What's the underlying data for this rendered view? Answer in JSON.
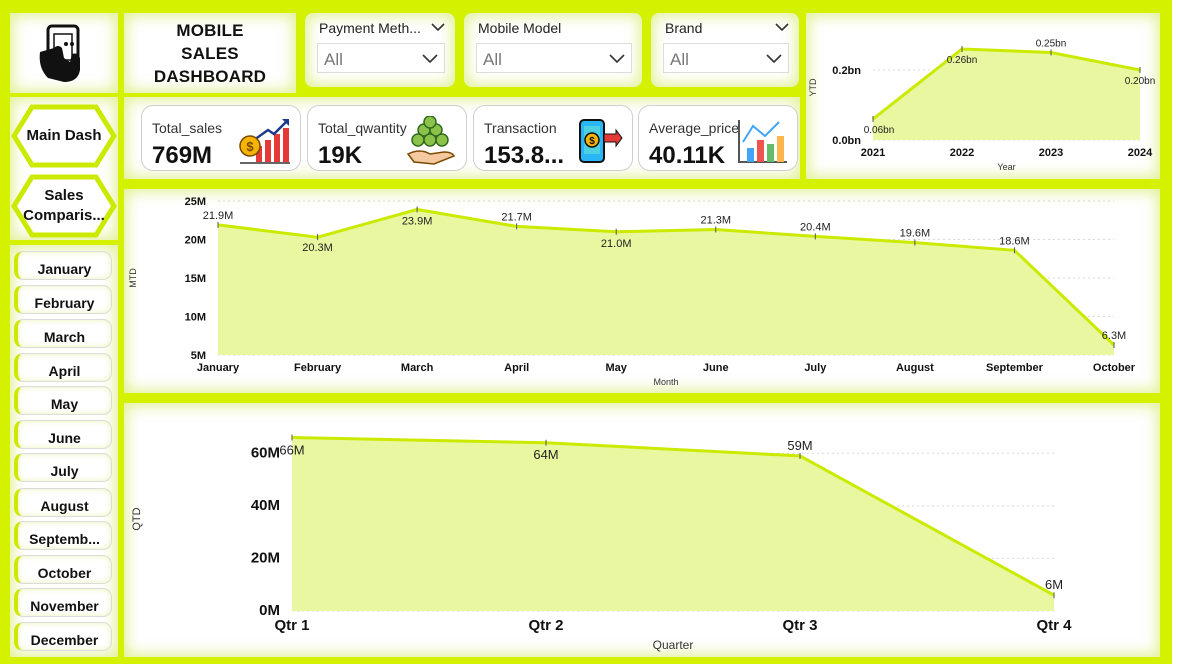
{
  "header": {
    "title_line1": "MOBILE",
    "title_line2": "SALES",
    "title_line3": "DASHBOARD",
    "logo_icon": "mobile-hand-icon"
  },
  "slicers": [
    {
      "label": "Payment Meth...",
      "value": "All"
    },
    {
      "label": "Mobile Model",
      "value": "All"
    },
    {
      "label": "Brand",
      "value": "All"
    }
  ],
  "kpis": [
    {
      "label": "Total_sales",
      "value": "769M",
      "icon": "sales-growth-icon"
    },
    {
      "label": "Total_qwantity",
      "value": "19K",
      "icon": "coins-hand-icon"
    },
    {
      "label": "Transaction",
      "value": "153.8...",
      "icon": "mobile-payment-icon"
    },
    {
      "label": "Average_price",
      "value": "40.11K",
      "icon": "bar-chart-icon"
    }
  ],
  "nav": {
    "main_dash": "Main Dash",
    "sales_line1": "Sales",
    "sales_line2": "Comparis..."
  },
  "months": [
    "January",
    "February",
    "March",
    "April",
    "May",
    "June",
    "July",
    "August",
    "Septemb...",
    "October",
    "November",
    "December"
  ],
  "colors": {
    "accent": "#d4f200",
    "area_fill": "#e8f7a0",
    "line": "#ccea00"
  },
  "chart_data": [
    {
      "type": "area",
      "title": "",
      "xlabel": "Year",
      "ylabel": "YTD",
      "x": [
        "2021",
        "2022",
        "2023",
        "2024"
      ],
      "values": [
        0.06,
        0.26,
        0.25,
        0.2
      ],
      "data_labels": [
        "0.06bn",
        "0.26bn",
        "0.25bn",
        "0.20bn"
      ],
      "y_ticks": [
        "0.0bn",
        "0.2bn"
      ],
      "ylim": [
        0,
        0.3
      ],
      "grid": true
    },
    {
      "type": "area",
      "title": "",
      "xlabel": "Month",
      "ylabel": "MTD",
      "x": [
        "January",
        "February",
        "March",
        "April",
        "May",
        "June",
        "July",
        "August",
        "September",
        "October"
      ],
      "values": [
        21.9,
        20.3,
        23.9,
        21.7,
        21.0,
        21.3,
        20.4,
        19.6,
        18.6,
        6.3
      ],
      "data_labels": [
        "21.9M",
        "20.3M",
        "23.9M",
        "21.7M",
        "21.0M",
        "21.3M",
        "20.4M",
        "19.6M",
        "18.6M",
        "6.3M"
      ],
      "y_ticks": [
        "5M",
        "10M",
        "15M",
        "20M",
        "25M"
      ],
      "ylim": [
        5,
        25
      ],
      "grid": true
    },
    {
      "type": "area",
      "title": "",
      "xlabel": "Quarter",
      "ylabel": "QTD",
      "x": [
        "Qtr 1",
        "Qtr 2",
        "Qtr 3",
        "Qtr 4"
      ],
      "values": [
        66,
        64,
        59,
        6
      ],
      "data_labels": [
        "66M",
        "64M",
        "59M",
        "6M"
      ],
      "y_ticks": [
        "0M",
        "20M",
        "40M",
        "60M"
      ],
      "ylim": [
        0,
        70
      ],
      "grid": true
    }
  ]
}
